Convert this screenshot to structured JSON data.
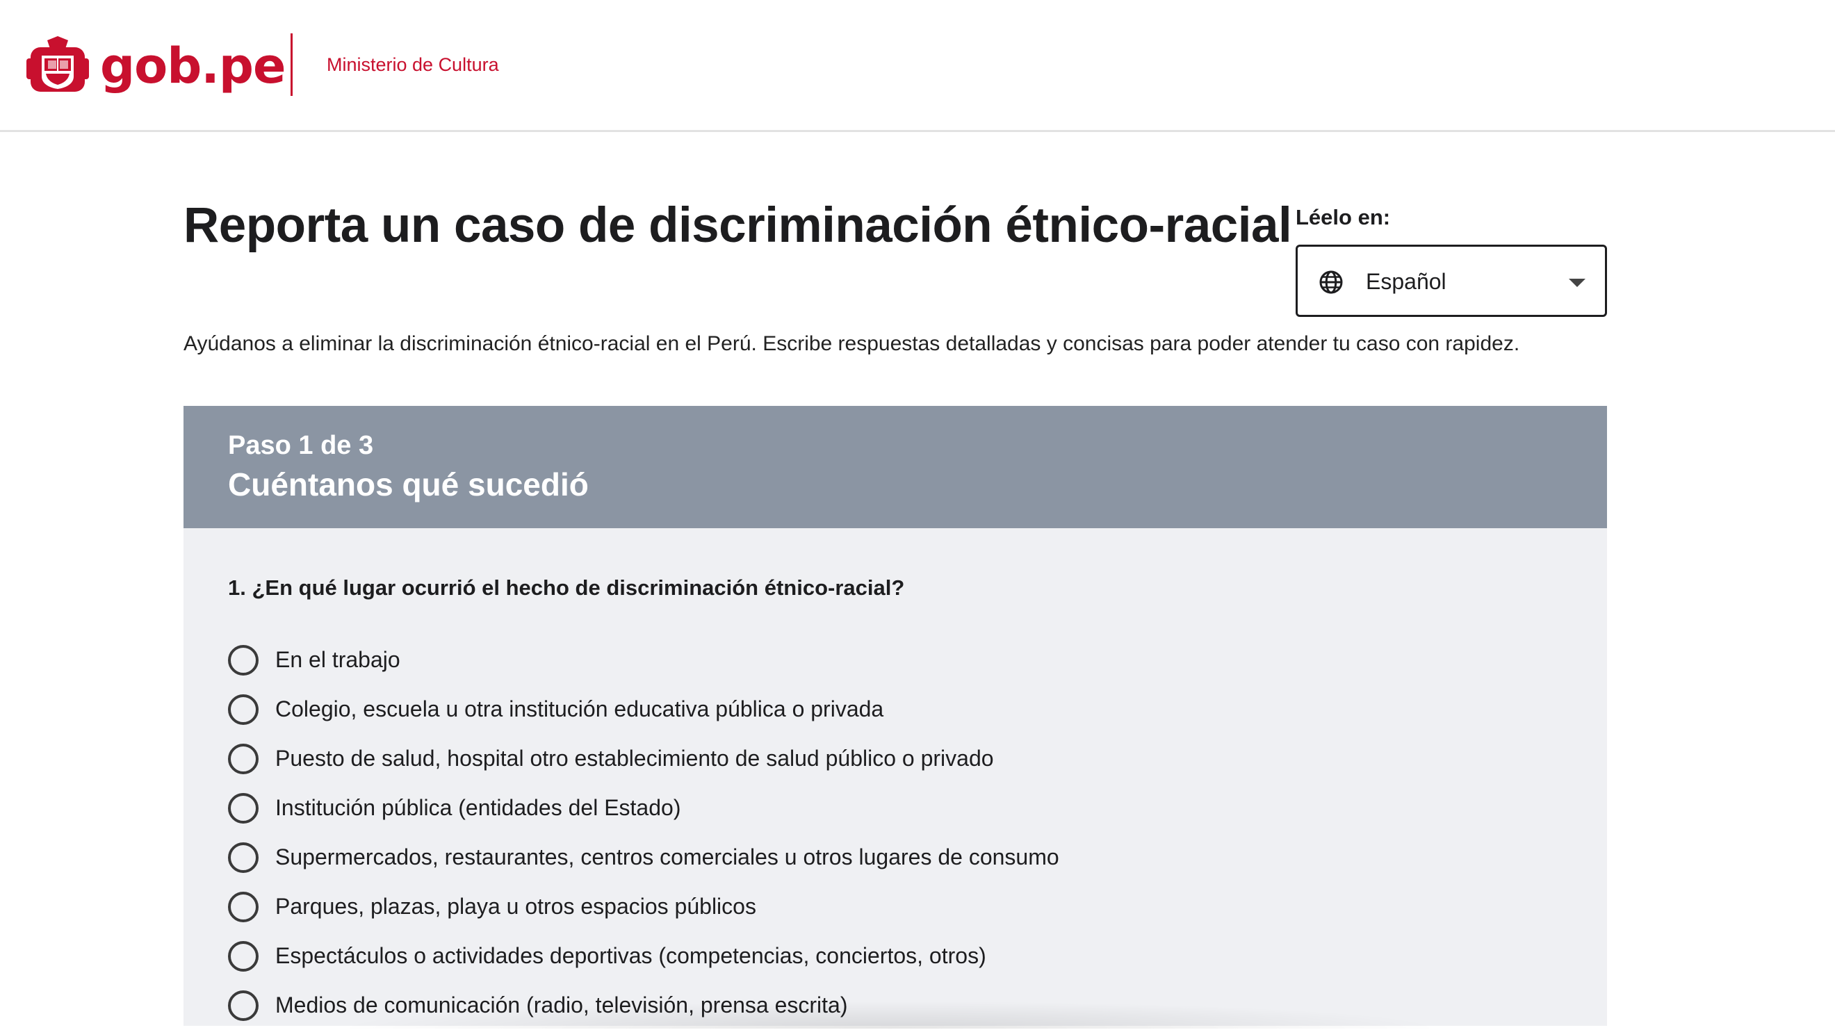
{
  "header": {
    "logo_text": "gob.pe",
    "ministry": "Ministerio de Cultura",
    "brand_color": "#c8102e"
  },
  "page": {
    "title": "Reporta un caso de discriminación étnico-racial",
    "intro": "Ayúdanos a eliminar la discriminación étnico-racial en el Perú. Escribe respuestas detalladas y concisas para poder atender tu caso con rapidez."
  },
  "language": {
    "label": "Léelo en:",
    "selected": "Español",
    "icon": "globe-icon"
  },
  "step": {
    "counter": "Paso 1 de 3",
    "title": "Cuéntanos qué sucedió",
    "header_color": "#8b95a3"
  },
  "question": {
    "text": "1. ¿En qué lugar ocurrió el hecho de discriminación étnico-racial?",
    "options": [
      "En el trabajo",
      "Colegio, escuela u otra institución educativa pública o privada",
      "Puesto de salud, hospital otro establecimiento de salud público o privado",
      "Institución pública (entidades del Estado)",
      "Supermercados, restaurantes, centros comerciales u otros lugares de consumo",
      "Parques, plazas, playa u otros espacios públicos",
      "Espectáculos o actividades deportivas (competencias, conciertos, otros)",
      "Medios de comunicación (radio, televisión, prensa escrita)"
    ]
  }
}
